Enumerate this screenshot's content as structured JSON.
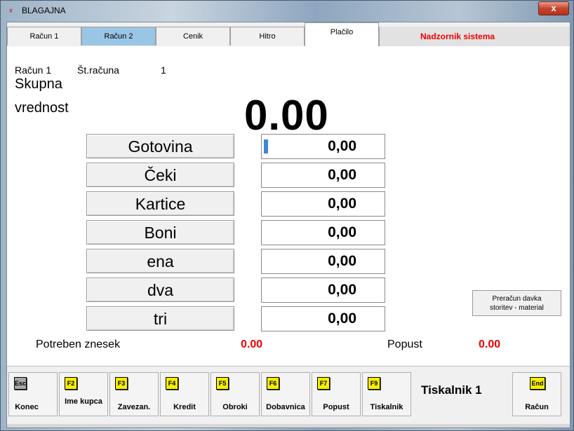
{
  "window": {
    "title": "BLAGAJNA",
    "close_label": "x"
  },
  "tabs": [
    {
      "label": "Račun 1"
    },
    {
      "label": "Račun 2"
    },
    {
      "label": "Cenik"
    },
    {
      "label": "Hitro"
    },
    {
      "label": "Plačilo"
    }
  ],
  "supervisor": "Nadzornik sistema",
  "info": {
    "account": "Račun 1",
    "number_label": "Št.računa",
    "number": "1",
    "total_label_1": "Skupna",
    "total_label_2": "vrednost",
    "total": "0.00"
  },
  "payments": [
    {
      "label": "Gotovina",
      "value": "0,00"
    },
    {
      "label": "Čeki",
      "value": "0,00"
    },
    {
      "label": "Kartice",
      "value": "0,00"
    },
    {
      "label": "Boni",
      "value": "0,00"
    },
    {
      "label": "ena",
      "value": "0,00"
    },
    {
      "label": "dva",
      "value": "0,00"
    },
    {
      "label": "tri",
      "value": "0,00"
    }
  ],
  "recalc": {
    "line1": "Preračun davka",
    "line2": "storitev - material"
  },
  "summary": {
    "required_label": "Potreben znesek",
    "required_value": "0.00",
    "discount_label": "Popust",
    "discount_value": "0.00"
  },
  "fkeys": [
    {
      "key": "Esc",
      "label": "Konec"
    },
    {
      "key": "F2",
      "label": "Ime kupca"
    },
    {
      "key": "F3",
      "label": "Zavezan."
    },
    {
      "key": "F4",
      "label": "Kredit"
    },
    {
      "key": "F5",
      "label": "Obroki"
    },
    {
      "key": "F6",
      "label": "Dobavnica"
    },
    {
      "key": "F7",
      "label": "Popust"
    },
    {
      "key": "F9",
      "label": "Tiskalnik"
    },
    {
      "key": "End",
      "label": "Račun"
    }
  ],
  "printer": "Tiskalnik 1",
  "colors": {
    "accent_red": "#e00000",
    "tab_blue": "#9ac6e6",
    "key_yellow": "#f5ee00"
  }
}
